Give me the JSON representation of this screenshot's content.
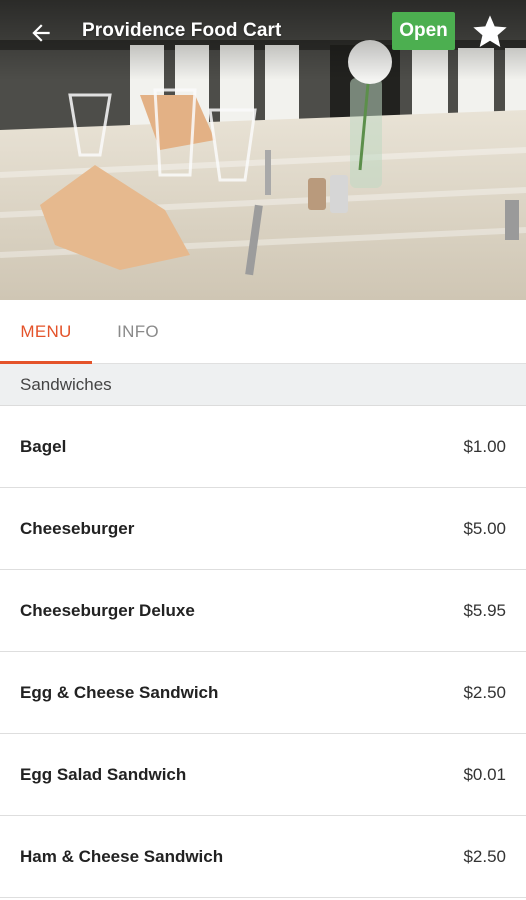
{
  "header": {
    "title": "Providence Food Cart",
    "status_badge": "Open",
    "badge_color": "#4caf50",
    "back_icon": "arrow-left-icon",
    "favorite_icon": "star-icon"
  },
  "hero_image": {
    "depicts": "restaurant-table-photo"
  },
  "tabs": [
    {
      "label": "MENU",
      "active": true
    },
    {
      "label": "INFO",
      "active": false
    }
  ],
  "accent_color": "#e4532a",
  "menu": {
    "section_title": "Sandwiches",
    "items": [
      {
        "name": "Bagel",
        "price": "$1.00"
      },
      {
        "name": "Cheeseburger",
        "price": "$5.00"
      },
      {
        "name": "Cheeseburger Deluxe",
        "price": "$5.95"
      },
      {
        "name": "Egg & Cheese Sandwich",
        "price": "$2.50"
      },
      {
        "name": "Egg Salad Sandwich",
        "price": "$0.01"
      },
      {
        "name": "Ham & Cheese Sandwich",
        "price": "$2.50"
      }
    ]
  }
}
